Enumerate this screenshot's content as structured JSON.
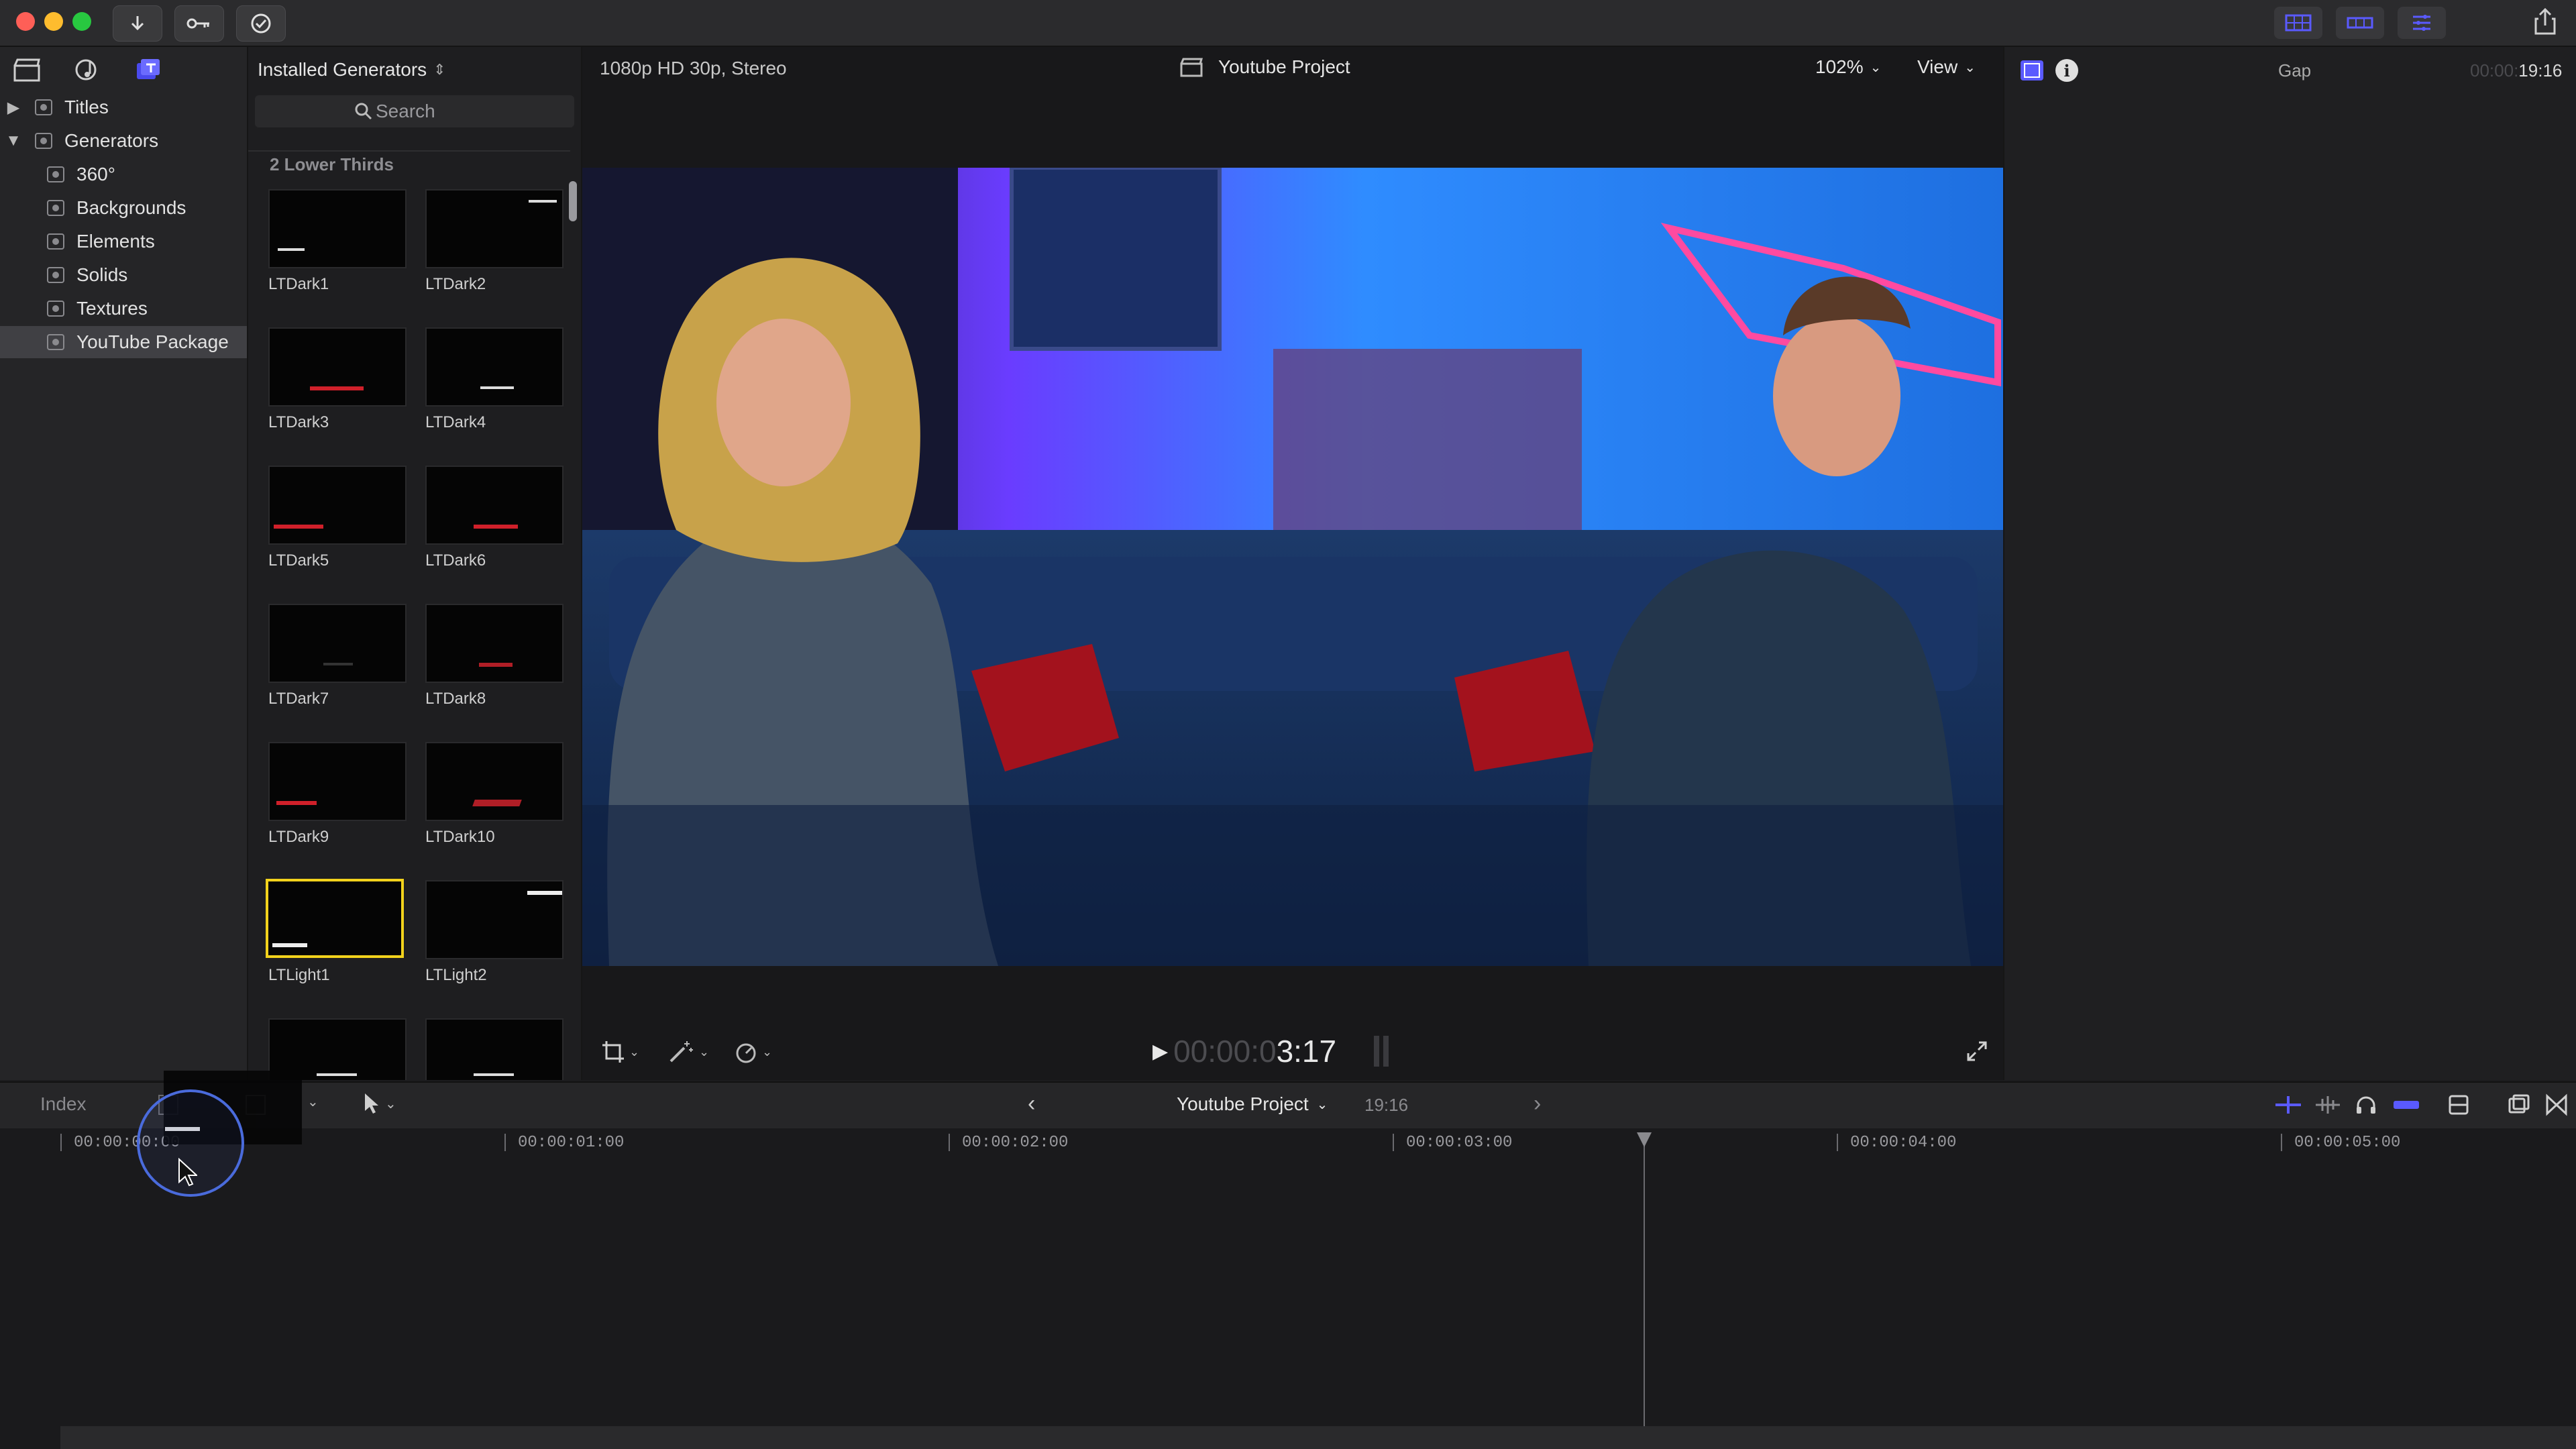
{
  "titlebar": {
    "import_icon": "download-arrow-icon",
    "keyword_icon": "key-icon",
    "check_icon": "checkmark-circle-icon",
    "right_icons": [
      "browser-layout-icon",
      "timeline-layout-icon",
      "inspector-layout-icon"
    ],
    "share_icon": "share-icon"
  },
  "sidebar": {
    "items": [
      {
        "label": "Titles",
        "expanded": false
      },
      {
        "label": "Generators",
        "expanded": true
      },
      {
        "label": "360°"
      },
      {
        "label": "Backgrounds"
      },
      {
        "label": "Elements"
      },
      {
        "label": "Solids"
      },
      {
        "label": "Textures"
      },
      {
        "label": "YouTube Package",
        "selected": true
      }
    ]
  },
  "browser": {
    "header": "Installed Generators",
    "search_placeholder": "Search",
    "section_title": "2 Lower Thirds",
    "thumbs": [
      {
        "label": "LTDark1"
      },
      {
        "label": "LTDark2"
      },
      {
        "label": "LTDark3"
      },
      {
        "label": "LTDark4"
      },
      {
        "label": "LTDark5"
      },
      {
        "label": "LTDark6"
      },
      {
        "label": "LTDark7"
      },
      {
        "label": "LTDark8"
      },
      {
        "label": "LTDark9"
      },
      {
        "label": "LTDark10"
      },
      {
        "label": "LTLight1",
        "selected": true
      },
      {
        "label": "LTLight2"
      }
    ]
  },
  "viewer": {
    "format": "1080p HD 30p, Stereo",
    "project_title": "Youtube Project",
    "zoom": "102%",
    "view_label": "View",
    "timecode_dim": "00:00:0",
    "timecode_bright": "3:17"
  },
  "inspector": {
    "gap_label": "Gap",
    "timecode_dim": "00:00:",
    "timecode": "19:16"
  },
  "timeline": {
    "index_label": "Index",
    "project_name": "Youtube Project",
    "duration": "19:16",
    "ruler": [
      "00:00:00:00",
      "00:00:01:00",
      "00:00:02:00",
      "00:00:03:00",
      "00:00:04:00",
      "00:00:05:00"
    ]
  },
  "colors": {
    "accent_blue": "#5a5aff",
    "selection_yellow": "#f2d21c",
    "lower_third_red": "#d0202a"
  }
}
